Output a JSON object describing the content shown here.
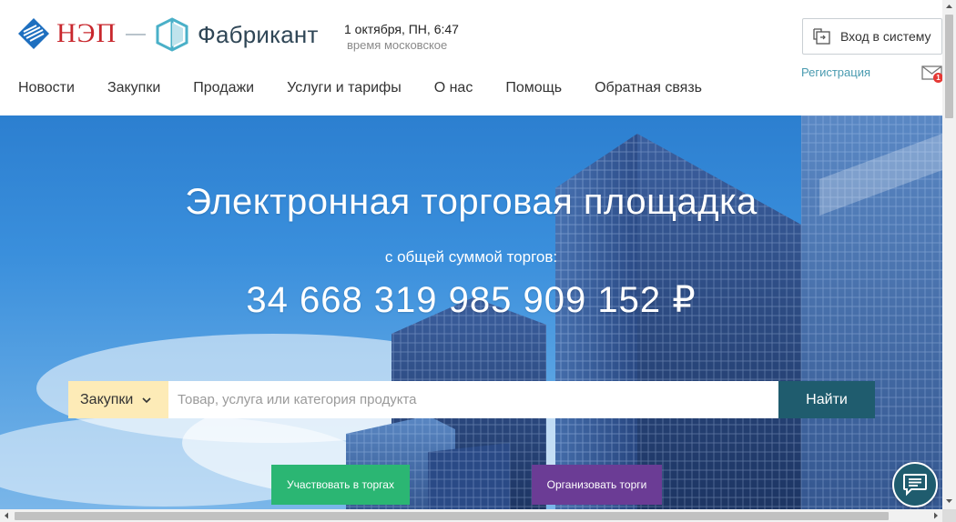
{
  "header": {
    "logo_nep_text": "НЭП",
    "logo_fabrikant_text": "Фабрикант",
    "date": "1 октября, ПН,  6:47",
    "timezone": "время московское",
    "login_label": "Вход в систему",
    "register_label": "Регистрация",
    "mail_badge_count": "1"
  },
  "nav": {
    "items": [
      "Новости",
      "Закупки",
      "Продажи",
      "Услуги и тарифы",
      "О нас",
      "Помощь",
      "Обратная связь"
    ]
  },
  "hero": {
    "title": "Электронная торговая площадка",
    "subtitle": "с общей суммой торгов:",
    "total_sum": "34 668 319 985 909 152 ₽"
  },
  "search": {
    "category": "Закупки",
    "placeholder": "Товар, услуга или категория продукта",
    "value": "",
    "button_label": "Найти"
  },
  "cta": {
    "participate_label": "Участвовать в торгах",
    "organize_label": "Организовать торги"
  },
  "colors": {
    "nep_red": "#c8272d",
    "nep_blue": "#1e6fbf",
    "fabrikant_teal": "#4ab0c8",
    "search_category_bg": "#fdebb7",
    "search_button_bg": "#1f5c6e",
    "cta_green": "#2bb673",
    "cta_purple": "#6b3c95"
  },
  "icons": {
    "login": "login-door-icon",
    "mail": "envelope-icon",
    "chat": "chat-bubble-icon",
    "dropdown": "chevron-down-icon"
  }
}
